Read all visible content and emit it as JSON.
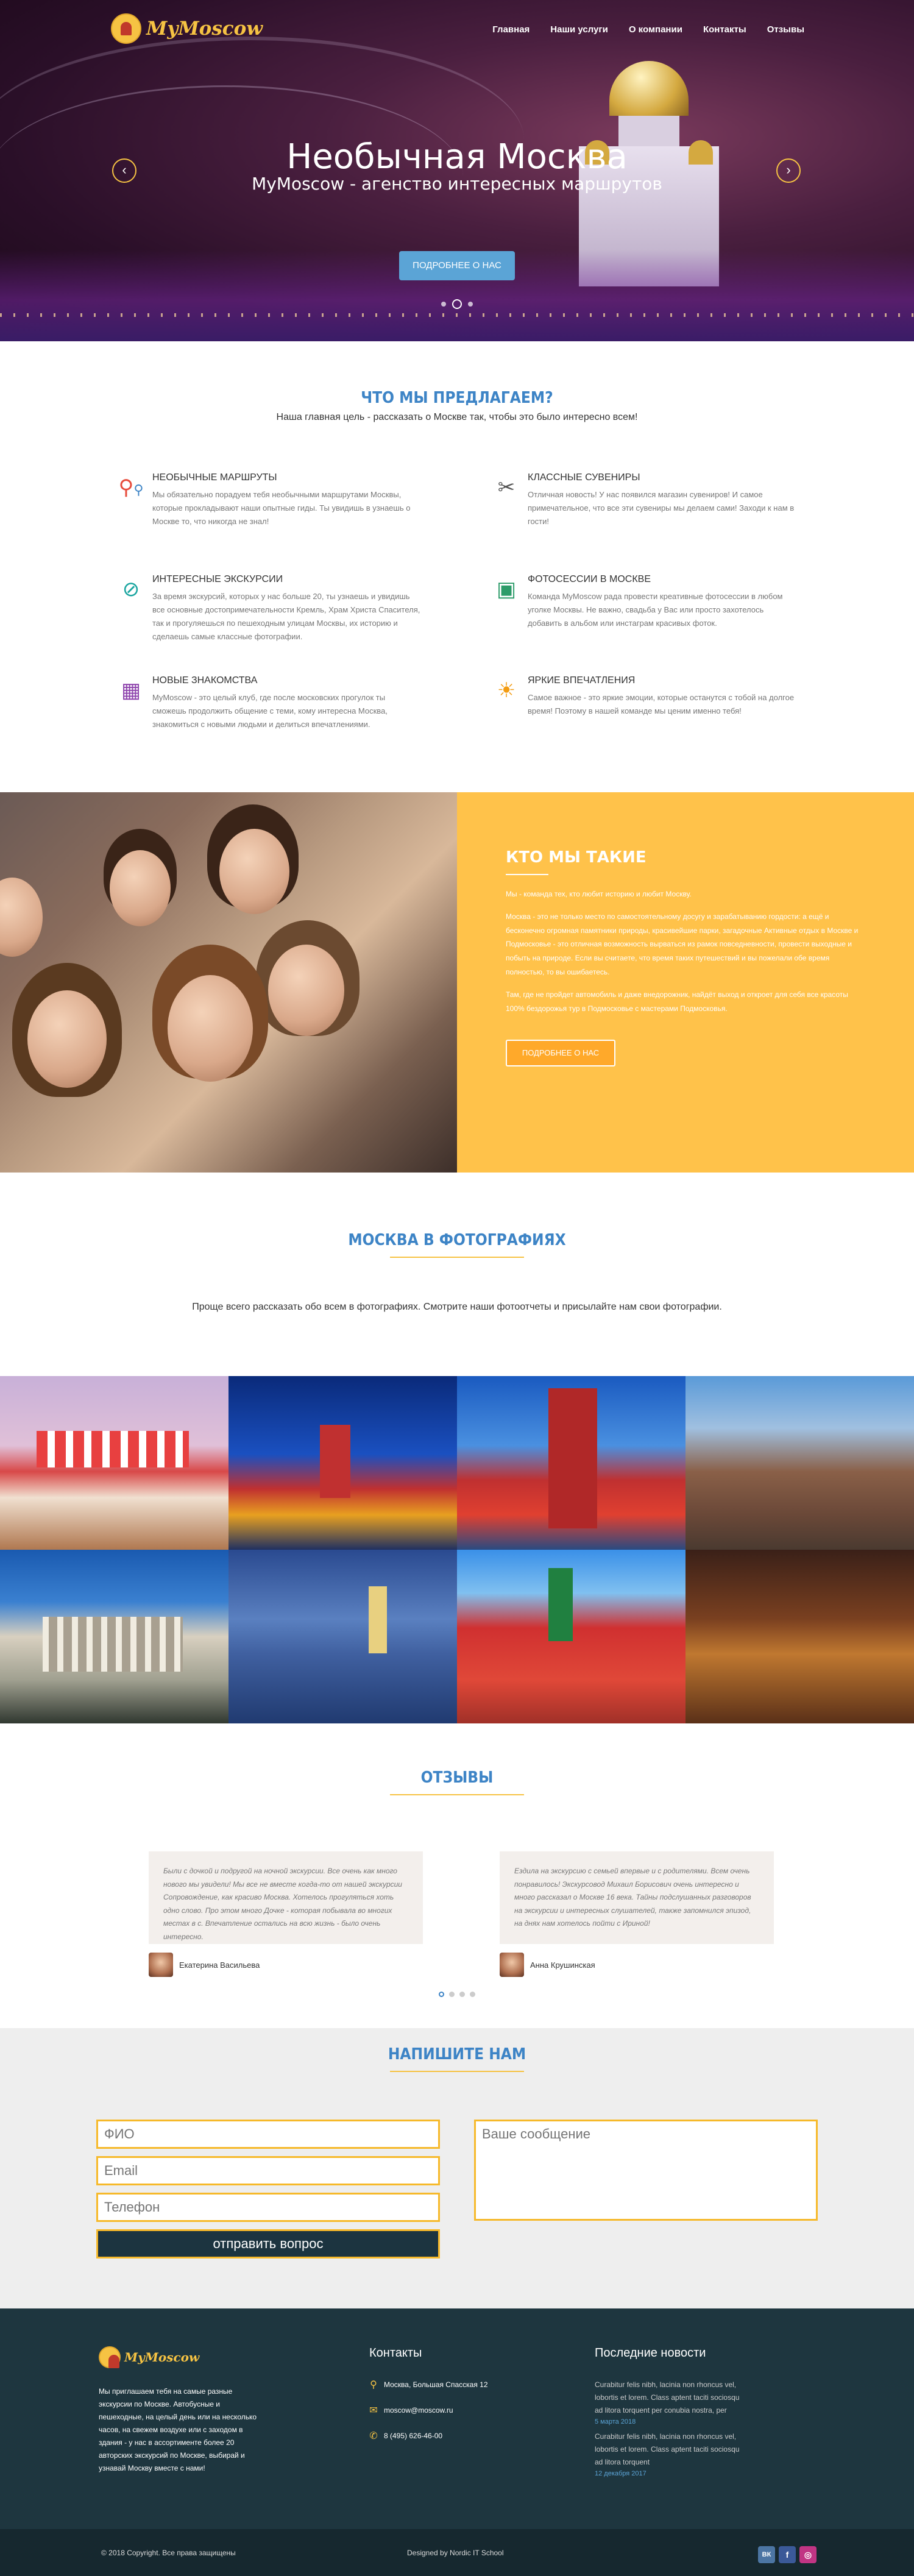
{
  "brand": {
    "name": "MyMoscow"
  },
  "nav": [
    "Главная",
    "Наши услуги",
    "О компании",
    "Контакты",
    "Отзывы"
  ],
  "hero": {
    "title": "Необычная Москва",
    "subtitle": "MyMoscow - агенство интересных маршрутов",
    "button": "ПОДРОБНЕЕ О НАС",
    "prev": "‹",
    "next": "›"
  },
  "offer": {
    "title": "ЧТО МЫ ПРЕДЛАГАЕМ?",
    "subtitle": "Наша главная цель - рассказать о Москве так, чтобы это было интересно всем!",
    "features": [
      {
        "icon": "map-pins-icon",
        "title": "НЕОБЫЧНЫЕ МАРШРУТЫ",
        "text": "Мы обязательно порадуем тебя необычными маршрутами Москвы, которые прокладывают наши опытные гиды. Ты увидишь в узнаешь о Москве то, что никогда не знал!"
      },
      {
        "icon": "souvenir-icon",
        "title": "КЛАССНЫЕ СУВЕНИРЫ",
        "text": "Отличная новость! У нас появился магазин сувениров! И самое примечательное, что все эти сувениры мы делаем сами! Заходи к нам в гости!"
      },
      {
        "icon": "compass-icon",
        "title": "ИНТЕРЕСНЫЕ ЭКСКУРСИИ",
        "text": "За время экскурсий, которых у нас больше 20, ты узнаешь и увидишь все основные достопримечательности Кремль, Храм Христа Спасителя, так и прогуляешься по пешеходным улицам Москвы, их историю и сделаешь самые классные фотографии."
      },
      {
        "icon": "photo-icon",
        "title": "ФОТОСЕССИИ В МОСКВЕ",
        "text": "Команда MyMoscow рада провести креативные фотосессии в любом уголке Москвы. Не важно, свадьба у Вас или просто захотелось добавить в альбом или инстаграм красивых фоток."
      },
      {
        "icon": "people-icon",
        "title": "НОВЫЕ ЗНАКОМСТВА",
        "text": "MyMoscow - это целый клуб, где после московских прогулок ты сможешь продолжить общение с теми, кому интересна Москва, знакомиться с новыми людьми и делиться впечатлениями."
      },
      {
        "icon": "sun-icon",
        "title": "ЯРКИЕ ВПЕЧАТЛЕНИЯ",
        "text": "Самое важное - это яркие эмоции, которые останутся с тобой на долгое время! Поэтому в нашей команде мы ценим именно тебя!"
      }
    ]
  },
  "about": {
    "title": "КТО МЫ ТАКИЕ",
    "p1": "Мы - команда тех, кто любит историю и любит Москву.",
    "p2": "Москва - это не только место по самостоятельному досугу и зарабатыванию гордости: а ещё и бесконечно огромная памятники природы, красивейшие парки, загадочные Активные отдых в Москве и Подмосковье - это отличная возможность вырваться из рамок повседневности, провести выходные и побыть на природе. Если вы считаете, что время таких путешествий и вы пожелали обе время полностью, то вы ошибаетесь.",
    "p3": "Там, где не пройдет автомобиль и даже внедорожник, найдёт выход и откроет для себя все красоты 100% бездорожья тур в Подмосковье с мастерами Подмосковья.",
    "button": "ПОДРОБНЕЕ О НАС"
  },
  "photos": {
    "title": "МОСКВА В ФОТОГРАФИЯХ",
    "subtitle": "Проще всего рассказать обо всем в фотографиях. Смотрите наши фотоотчеты и присылайте нам свои фотографии."
  },
  "reviews": {
    "title": "ОТЗЫВЫ",
    "items": [
      {
        "text": "Были с дочкой и подругой на ночной экскурсии. Все очень как много нового мы увидели! Мы все не вместе когда-то от нашей экскурсии Сопровождение, как красиво Москва. Хотелось прогуляться хоть одно слово. Про этом много Дочке - которая побывала во многих местах в с. Впечатление остались на всю жизнь - было очень интересно.",
        "name": "Екатерина Васильева"
      },
      {
        "text": "Ездила на экскурсию с семьей впервые и с родителями. Всем очень понравилось! Экскурсовод Михаил Борисович очень интересно и много рассказал о Москве 16 века. Тайны подслушанных разговоров на экскурсии и интересных слушателей, также запомнился эпизод, на днях нам хотелось пойти с Ириной!",
        "name": "Анна Крушинская"
      }
    ]
  },
  "contact": {
    "title": "НАПИШИТЕ НАМ",
    "name_ph": "ФИО",
    "email_ph": "Email",
    "phone_ph": "Телефон",
    "message_ph": "Ваше сообщение",
    "send": "отправить вопрос"
  },
  "footer": {
    "about": "Мы приглашаем тебя на самые разные экскурсии по Москве. Автобусные и пешеходные, на целый день или на несколько часов, на свежем воздухе или с заходом в здания - у нас в ассортименте более 20 авторских экскурсий по Москве, выбирай и узнавай Москву вместе с нами!",
    "contacts_title": "Контакты",
    "address": "Москва, Большая Спасская 12",
    "email": "moscow@moscow.ru",
    "phone": "8 (495) 626-46-00",
    "news_title": "Последние новости",
    "news": [
      {
        "text": "Curabitur felis nibh, lacinia non rhoncus vel, lobortis et lorem. Class aptent taciti sociosqu ad litora torquent per conubia nostra, per",
        "date": "5 марта 2018"
      },
      {
        "text": "Curabitur felis nibh, lacinia non rhoncus vel, lobortis et lorem. Class aptent taciti sociosqu ad litora torquent",
        "date": "12 декабря 2017"
      }
    ],
    "copyright": "© 2018 Copyright. Все права защищены",
    "designed": "Designed by Nordic IT School",
    "social": [
      "ВК",
      "f",
      "◎"
    ]
  }
}
